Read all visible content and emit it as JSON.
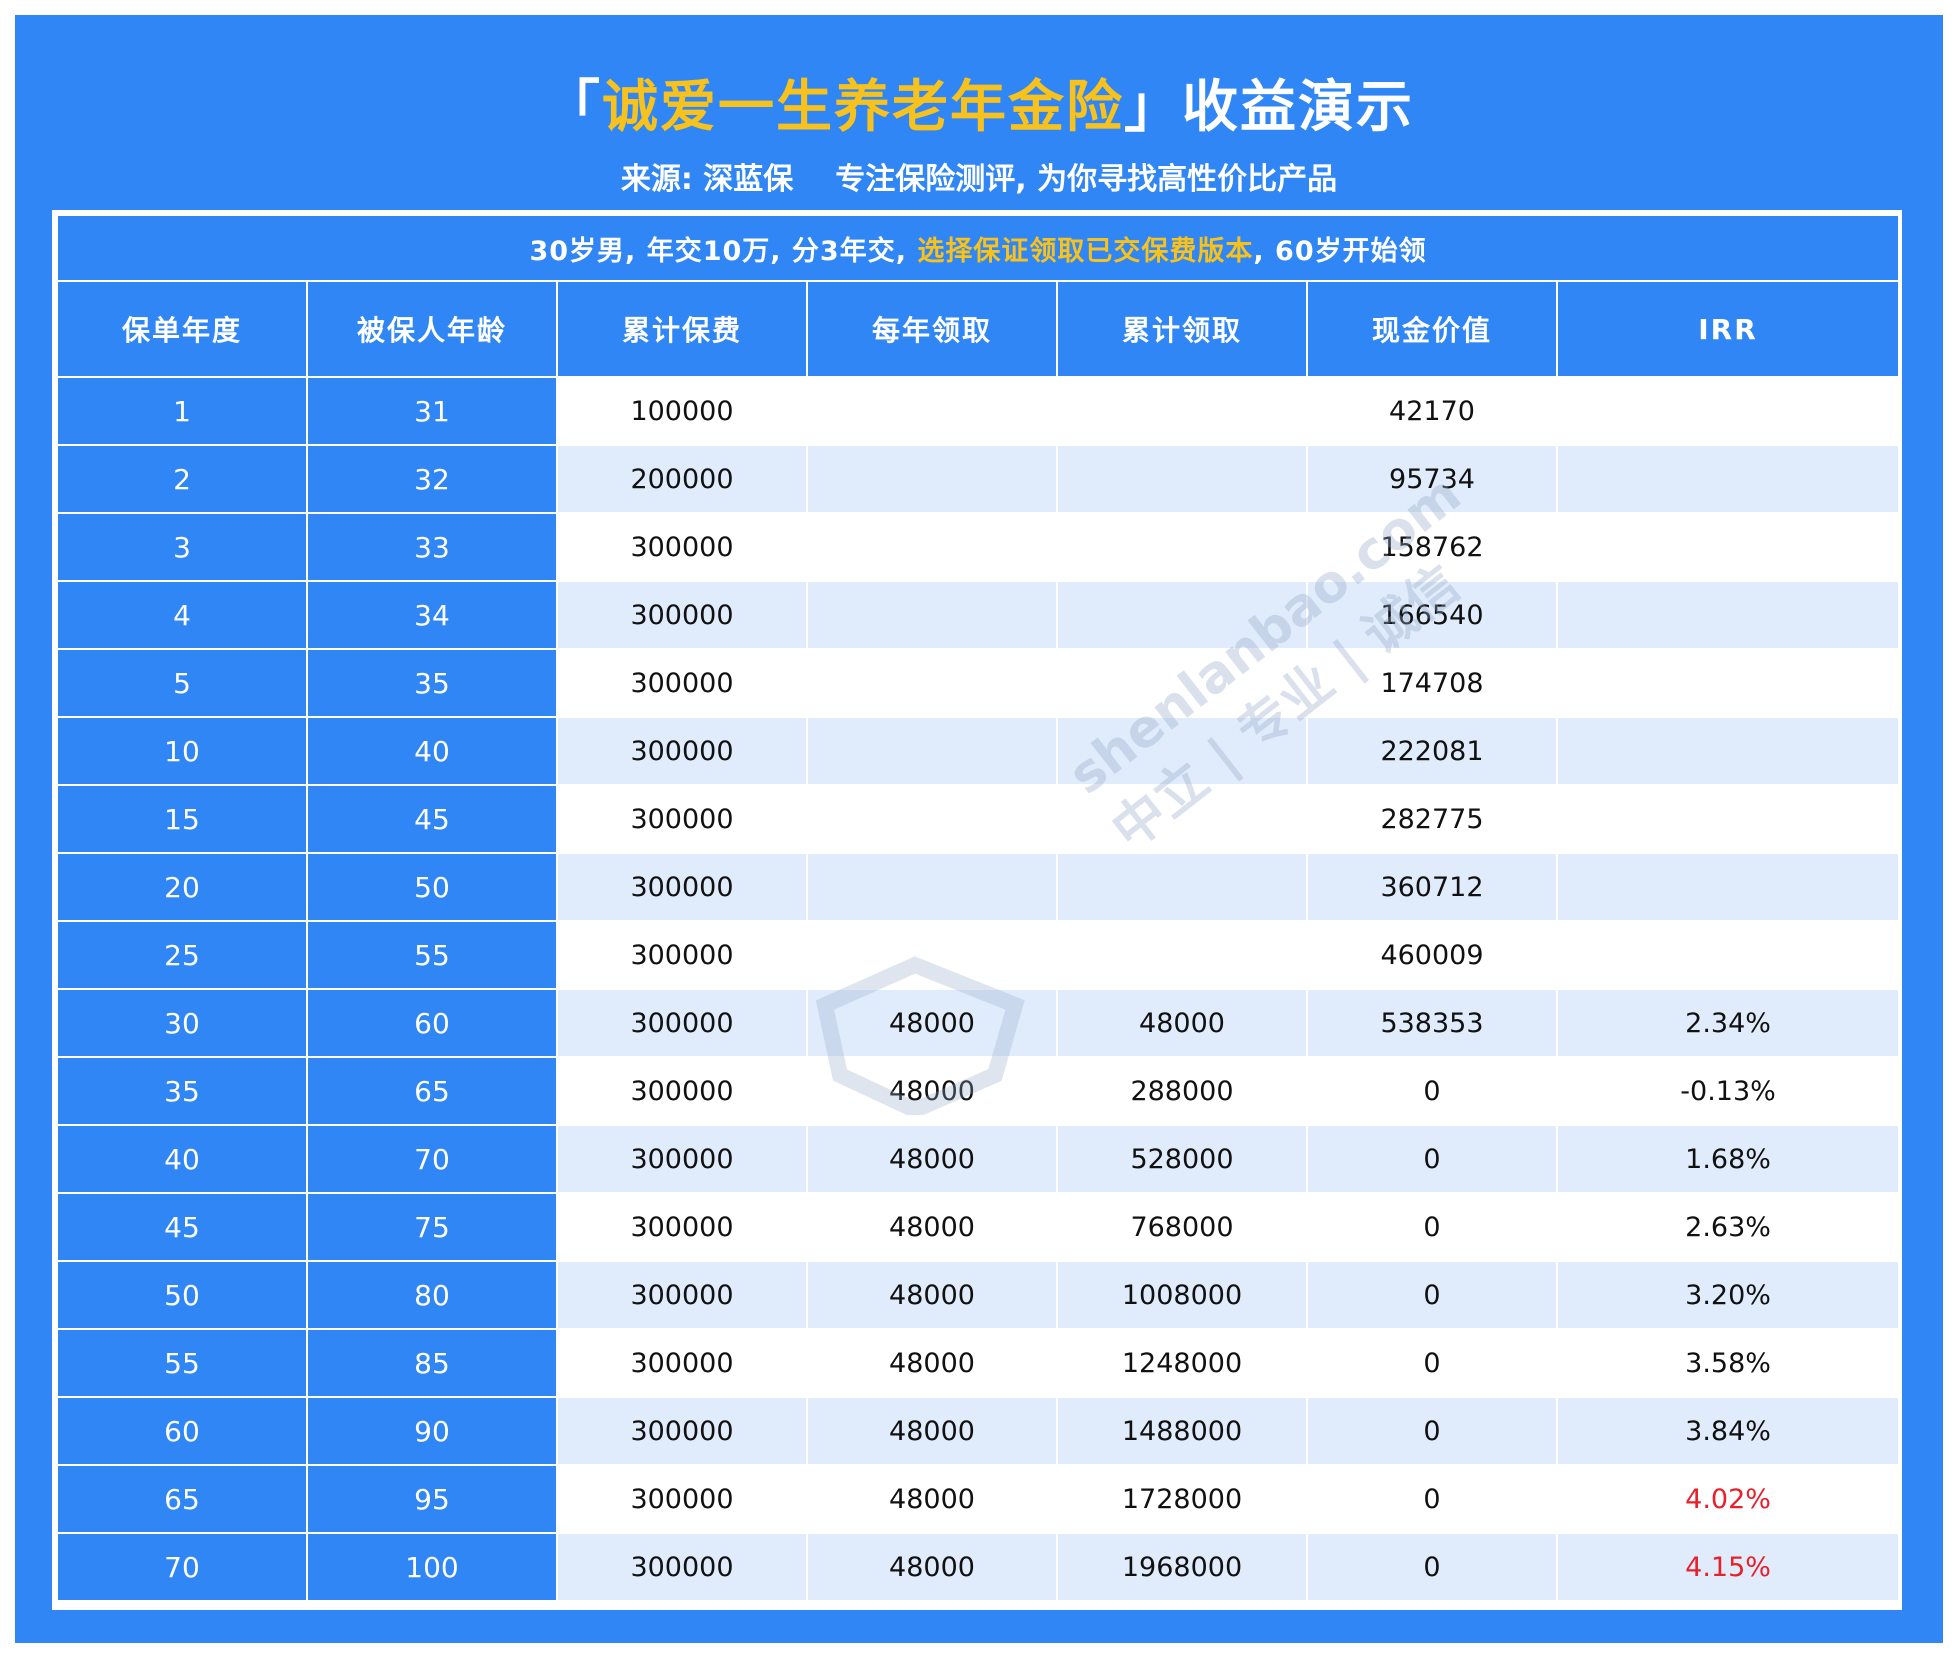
{
  "title": {
    "open_bracket": "「",
    "product": "诚爱一生养老年金险",
    "close_bracket": "」",
    "suffix": "收益演示"
  },
  "subtitle": {
    "source": "来源: 深蓝保",
    "slogan": "专注保险测评, 为你寻找高性价比产品"
  },
  "caption": {
    "part1": "30岁男, 年交10万, 分3年交, ",
    "highlight": "选择保证领取已交保费版本",
    "part2": ", 60岁开始领"
  },
  "headers": [
    "保单年度",
    "被保人年龄",
    "累计保费",
    "每年领取",
    "累计领取",
    "现金价值",
    "IRR"
  ],
  "rows": [
    {
      "year": "1",
      "age": "31",
      "premium": "100000",
      "annual": "",
      "cumulative": "",
      "cash": "42170",
      "irr": "",
      "red": false
    },
    {
      "year": "2",
      "age": "32",
      "premium": "200000",
      "annual": "",
      "cumulative": "",
      "cash": "95734",
      "irr": "",
      "red": false
    },
    {
      "year": "3",
      "age": "33",
      "premium": "300000",
      "annual": "",
      "cumulative": "",
      "cash": "158762",
      "irr": "",
      "red": false
    },
    {
      "year": "4",
      "age": "34",
      "premium": "300000",
      "annual": "",
      "cumulative": "",
      "cash": "166540",
      "irr": "",
      "red": false
    },
    {
      "year": "5",
      "age": "35",
      "premium": "300000",
      "annual": "",
      "cumulative": "",
      "cash": "174708",
      "irr": "",
      "red": false
    },
    {
      "year": "10",
      "age": "40",
      "premium": "300000",
      "annual": "",
      "cumulative": "",
      "cash": "222081",
      "irr": "",
      "red": false
    },
    {
      "year": "15",
      "age": "45",
      "premium": "300000",
      "annual": "",
      "cumulative": "",
      "cash": "282775",
      "irr": "",
      "red": false
    },
    {
      "year": "20",
      "age": "50",
      "premium": "300000",
      "annual": "",
      "cumulative": "",
      "cash": "360712",
      "irr": "",
      "red": false
    },
    {
      "year": "25",
      "age": "55",
      "premium": "300000",
      "annual": "",
      "cumulative": "",
      "cash": "460009",
      "irr": "",
      "red": false
    },
    {
      "year": "30",
      "age": "60",
      "premium": "300000",
      "annual": "48000",
      "cumulative": "48000",
      "cash": "538353",
      "irr": "2.34%",
      "red": false
    },
    {
      "year": "35",
      "age": "65",
      "premium": "300000",
      "annual": "48000",
      "cumulative": "288000",
      "cash": "0",
      "irr": "-0.13%",
      "red": false
    },
    {
      "year": "40",
      "age": "70",
      "premium": "300000",
      "annual": "48000",
      "cumulative": "528000",
      "cash": "0",
      "irr": "1.68%",
      "red": false
    },
    {
      "year": "45",
      "age": "75",
      "premium": "300000",
      "annual": "48000",
      "cumulative": "768000",
      "cash": "0",
      "irr": "2.63%",
      "red": false
    },
    {
      "year": "50",
      "age": "80",
      "premium": "300000",
      "annual": "48000",
      "cumulative": "1008000",
      "cash": "0",
      "irr": "3.20%",
      "red": false
    },
    {
      "year": "55",
      "age": "85",
      "premium": "300000",
      "annual": "48000",
      "cumulative": "1248000",
      "cash": "0",
      "irr": "3.58%",
      "red": false
    },
    {
      "year": "60",
      "age": "90",
      "premium": "300000",
      "annual": "48000",
      "cumulative": "1488000",
      "cash": "0",
      "irr": "3.84%",
      "red": false
    },
    {
      "year": "65",
      "age": "95",
      "premium": "300000",
      "annual": "48000",
      "cumulative": "1728000",
      "cash": "0",
      "irr": "4.02%",
      "red": true
    },
    {
      "year": "70",
      "age": "100",
      "premium": "300000",
      "annual": "48000",
      "cumulative": "1968000",
      "cash": "0",
      "irr": "4.15%",
      "red": true
    }
  ],
  "watermark": {
    "domain": "shenlanbao.com",
    "values": "中立 | 专业 | 诚信"
  },
  "colors": {
    "frame_blue": "#2f86f4",
    "highlight_yellow": "#f7c11e",
    "stripe": "#e0ecfc",
    "irr_red": "#e8202a"
  }
}
